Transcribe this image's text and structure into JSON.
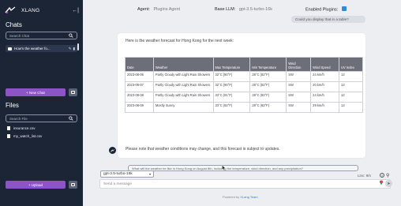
{
  "sidebar": {
    "app_name": "XLANG",
    "collapse_glyph": "←|",
    "chats_title": "Chats",
    "chat_search_placeholder": "Search Chat",
    "chat_item_label": "How's the weather fo...",
    "new_chat_label": "+  New Chat",
    "files_title": "Files",
    "file_search_placeholder": "Search File",
    "files": [
      "insurance.csv",
      "my_watch_list.csv"
    ],
    "upload_label": "+  Upload"
  },
  "topbar": {
    "agent_label": "Agent:",
    "agent_value": "Plugins Agent",
    "llm_label": "Base LLM:",
    "llm_value": "gpt-3.5-turbo-16k",
    "plugins_label": "Enabled Plugins:"
  },
  "user_message": "Could you display that in a table?",
  "answer": {
    "intro": "Here is the weather forecast for Hong Kong for the next week:",
    "table": {
      "headers": [
        "Date",
        "Weather",
        "Max Temperature",
        "Min Temperature",
        "Wind Direction",
        "Wind Speed",
        "UV Index"
      ],
      "rows": [
        [
          "2023-08-06",
          "Partly Cloudy with Light Rain Showers",
          "32°C (90°F)",
          "28°C (82°F)",
          "SW",
          "24 km/h",
          "12"
        ],
        [
          "2023-08-07",
          "Partly Cloudy with Light Rain Showers",
          "32°C (90°F)",
          "28°C (82°F)",
          "SW",
          "20 km/h",
          "12"
        ],
        [
          "2023-08-08",
          "Partly Cloudy with Light Rain Showers",
          "33°C (91°F)",
          "28°C (83°F)",
          "SW",
          "24 km/h",
          "12"
        ],
        [
          "2023-08-09",
          "Mostly Sunny",
          "33°C (92°F)",
          "28°C (83°F)",
          "SW",
          "29 km/h",
          "12"
        ]
      ]
    },
    "outro": "Please note that weather conditions may change, and this forecast is subject to updates."
  },
  "suggestion": "What will the weather be like in Hong Kong on August 8th, including the temperature, wind direction, and any precipitation?",
  "model_select": "gpt-3.5-turbo-16k",
  "model_arrow": "▾",
  "linc_text": "Linc: 9/n",
  "input_placeholder": "Send a message",
  "footer_prefix": "Powered by",
  "footer_link": "XLang Team",
  "colors": {
    "sidebar_bg": "#1c2536",
    "accent_purple": "#8d54c8",
    "table_header": "#6d6f78",
    "plugin_blue": "#2f89e0"
  }
}
